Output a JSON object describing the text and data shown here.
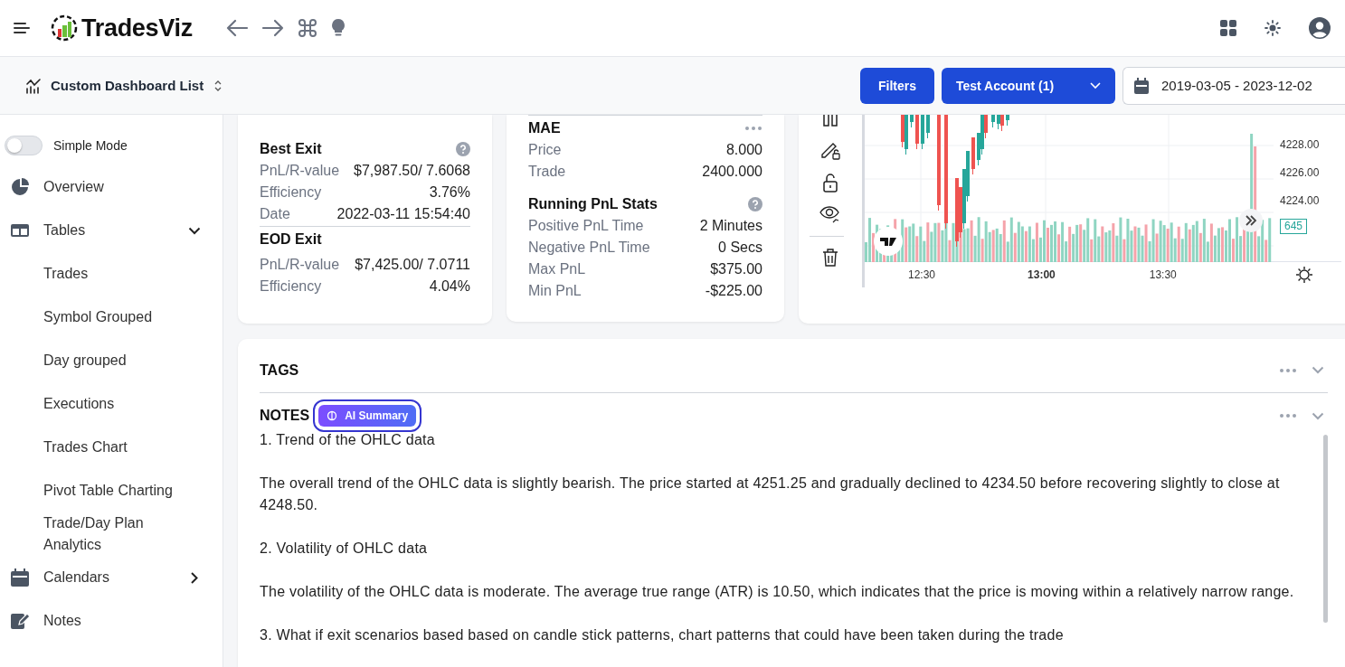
{
  "header": {
    "logo_text": "TradesViz"
  },
  "subheader": {
    "title": "Custom Dashboard List",
    "filters_button": "Filters",
    "account_button": "Test Account (1)",
    "date_range": "2019-03-05 - 2023-12-02"
  },
  "sidebar": {
    "simple_mode": {
      "label": "Simple Mode",
      "on": false
    },
    "items": [
      {
        "label": "Overview"
      },
      {
        "label": "Tables",
        "expanded": true,
        "children": [
          {
            "label": "Trades"
          },
          {
            "label": "Symbol Grouped"
          },
          {
            "label": "Day grouped"
          },
          {
            "label": "Executions"
          },
          {
            "label": "Trades Chart"
          },
          {
            "label": "Pivot Table Charting"
          },
          {
            "label": "Trade/Day Plan Analytics"
          }
        ]
      },
      {
        "label": "Calendars",
        "expanded": false
      },
      {
        "label": "Notes"
      }
    ]
  },
  "stat_cards": [
    {
      "top_rule": false,
      "sections": [
        {
          "title": "Best Exit",
          "help": true,
          "more": false,
          "rule_after": true,
          "rows": [
            [
              "PnL/R-value",
              "$7,987.50/ 7.6068"
            ],
            [
              "Efficiency",
              "3.76%"
            ],
            [
              "Date",
              "2022-03-11 15:54:40"
            ]
          ]
        },
        {
          "title": "EOD Exit",
          "help": false,
          "more": false,
          "rule_after": false,
          "rows": [
            [
              "PnL/R-value",
              "$7,425.00/ 7.0711"
            ],
            [
              "Efficiency",
              "4.04%"
            ]
          ]
        }
      ]
    },
    {
      "top_rule": true,
      "sections": [
        {
          "title": "MAE",
          "help": false,
          "more": true,
          "rule_after": false,
          "rows": [
            [
              "Price",
              "8.000"
            ],
            [
              "Trade",
              "2400.000"
            ]
          ]
        },
        {
          "title": "Running PnL Stats",
          "help": true,
          "more": false,
          "rule_after": false,
          "rows": [
            [
              "Positive PnL Time",
              "2 Minutes"
            ],
            [
              "Negative PnL Time",
              "0 Secs"
            ],
            [
              "Max PnL",
              "$375.00"
            ],
            [
              "Min PnL",
              "-$225.00"
            ]
          ]
        }
      ]
    }
  ],
  "chart": {
    "price_labels": [
      "4228.00",
      "4226.00",
      "4224.00"
    ],
    "volume_badge": "645",
    "time_labels": [
      {
        "label": "12:30",
        "major": false
      },
      {
        "label": "13:00",
        "major": true
      },
      {
        "label": "13:30",
        "major": false
      }
    ]
  },
  "notes_panel": {
    "sections": [
      {
        "title": "TAGS",
        "expanded": false
      },
      {
        "title": "NOTES",
        "expanded": false,
        "badge": "AI Summary",
        "paragraphs": [
          "1. Trend of the OHLC data",
          "The overall trend of the OHLC data is slightly bearish. The price started at 4251.25 and gradually declined to 4234.50 before recovering slightly to close at 4248.50.",
          "2. Volatility of OHLC data",
          "The volatility of the OHLC data is moderate. The average true range (ATR) is 10.50, which indicates that the price is moving within a relatively narrow range.",
          "3. What if exit scenarios based based on candle stick patterns, chart patterns that could have been taken during the trade"
        ]
      }
    ]
  }
}
